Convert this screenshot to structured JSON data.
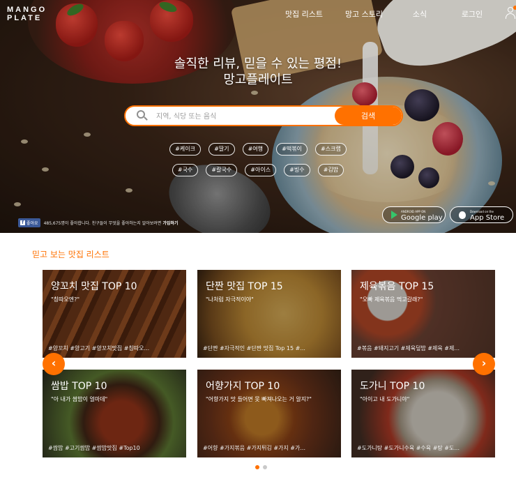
{
  "logo": {
    "line1": "MANGO",
    "line2": "PLATE"
  },
  "nav": {
    "items": [
      "맛집 리스트",
      "망고 스토리",
      "소식",
      "로그인"
    ]
  },
  "hero": {
    "headline_line1": "솔직한 리뷰, 믿을 수 있는 평점!",
    "headline_line2": "망고플레이트"
  },
  "search": {
    "placeholder": "지역, 식당 또는 음식",
    "button_label": "검색"
  },
  "tags": {
    "row1": [
      "#케이크",
      "#딸기",
      "#여행",
      "#떡볶이",
      "#스크랩"
    ],
    "row2": [
      "#국수",
      "#칼국수",
      "#아이스",
      "#빙수",
      "#김밥"
    ]
  },
  "facebook": {
    "like_label": "좋아요",
    "text": "485,675명이 좋아합니다. 친구들이 무엇을 좋아하는지 알아보려면",
    "join_label": "가입하기"
  },
  "store": {
    "google_small": "ANDROID APP ON",
    "google_big": "Google play",
    "apple_small": "Download on the",
    "apple_big": "App Store"
  },
  "section": {
    "title": "믿고 보는 맛집 리스트"
  },
  "cards": [
    {
      "title": "양꼬치 맛집 TOP 10",
      "quote": "\"칭따오엔?\"",
      "keywords": "#양꼬치 #양고기 #양꼬치맛집 #칭따오..."
    },
    {
      "title": "단짠 맛집 TOP 15",
      "quote": "\"나처럼 자극적이야\"",
      "keywords": "#단짠 #자극적인 #단짠 맛집 Top 15 #..."
    },
    {
      "title": "제육볶음 TOP 15",
      "quote": "\"오빠 제육볶음 먹고갈래?\"",
      "keywords": "#볶음 #돼지고기 #제육덮밥 #제육 #제..."
    },
    {
      "title": "쌈밥 TOP 10",
      "quote": "\"아 내가 쌈밥이 얼마데\"",
      "keywords": "#쌈밥 #고기쌈밥 #쌈밥맛집 #Top10"
    },
    {
      "title": "어향가지 TOP 10",
      "quote": "\"어향가지 맛 들어면 못 빠져나오는 거 알지?\"",
      "keywords": "#어향 #가지볶음 #가지튀김 #가지 #가..."
    },
    {
      "title": "도가니 TOP 10",
      "quote": "\"아이고 내 도가니야\"",
      "keywords": "#도가니탕 #도가니수육 #수육 #탕 #도..."
    }
  ],
  "carousel": {
    "prev": "‹",
    "next": "›",
    "pages": 2,
    "current": 1
  },
  "colors": {
    "accent": "#ff7100",
    "facebook": "#3b5998"
  }
}
